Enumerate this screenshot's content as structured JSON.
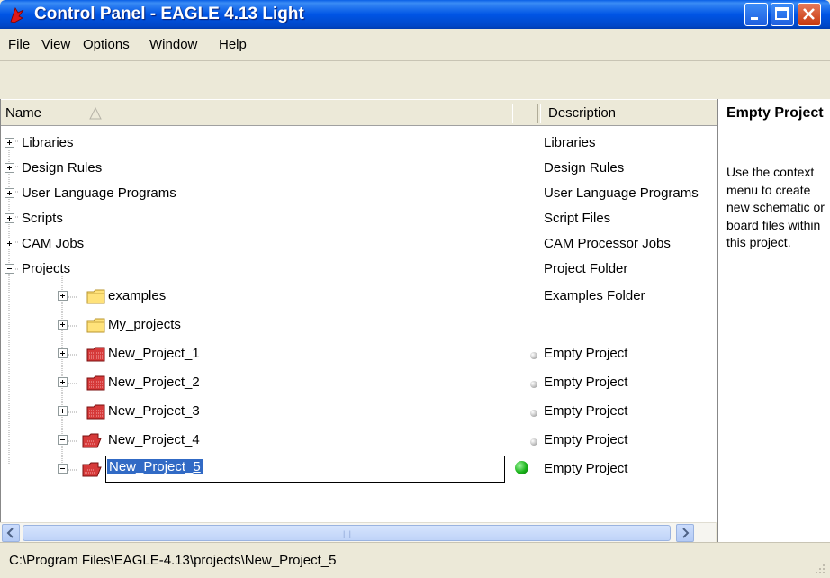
{
  "window": {
    "title": "Control Panel - EAGLE 4.13 Light",
    "app_icon": "eagle-icon",
    "buttons": {
      "minimize": "minimize-icon",
      "maximize": "maximize-icon",
      "close": "close-icon"
    }
  },
  "menu": [
    {
      "pre": "",
      "ul": "F",
      "post": "ile"
    },
    {
      "pre": "",
      "ul": "V",
      "post": "iew"
    },
    {
      "pre": "",
      "ul": "O",
      "post": "ptions"
    },
    {
      "pre": "",
      "ul": "W",
      "post": "indow"
    },
    {
      "pre": "",
      "ul": "H",
      "post": "elp"
    }
  ],
  "columns": {
    "name": "Name",
    "description": "Description"
  },
  "tree": {
    "libraries": {
      "name": "Libraries",
      "desc": "Libraries"
    },
    "design_rules": {
      "name": "Design Rules",
      "desc": "Design Rules"
    },
    "ulp": {
      "name": "User Language Programs",
      "desc": "User Language Programs"
    },
    "scripts": {
      "name": "Scripts",
      "desc": "Script Files"
    },
    "cam": {
      "name": "CAM Jobs",
      "desc": "CAM Processor Jobs"
    },
    "projects": {
      "name": "Projects",
      "desc": "Project Folder"
    },
    "examples": {
      "name": "examples",
      "desc": "Examples Folder"
    },
    "my_projects": {
      "name": "My_projects",
      "desc": ""
    },
    "p1": {
      "name": "New_Project_1",
      "desc": "Empty Project"
    },
    "p2": {
      "name": "New_Project_2",
      "desc": "Empty Project"
    },
    "p3": {
      "name": "New_Project_3",
      "desc": "Empty Project"
    },
    "p4": {
      "name": "New_Project_4",
      "desc": "Empty Project"
    },
    "p5": {
      "name_pre": "New_Project_",
      "name_ul": "5",
      "desc": "Empty Project"
    }
  },
  "info": {
    "title": "Empty Project",
    "body": "Use the context menu to create new schematic or board files within this project."
  },
  "status": {
    "path": "C:\\Program Files\\EAGLE-4.13\\projects\\New_Project_5"
  },
  "colors": {
    "title_bar": "#0055e5",
    "selection": "#316ac5",
    "active_dot": "#19b219",
    "project_folder": "#d63a3a",
    "folder": "#ffe27a"
  }
}
